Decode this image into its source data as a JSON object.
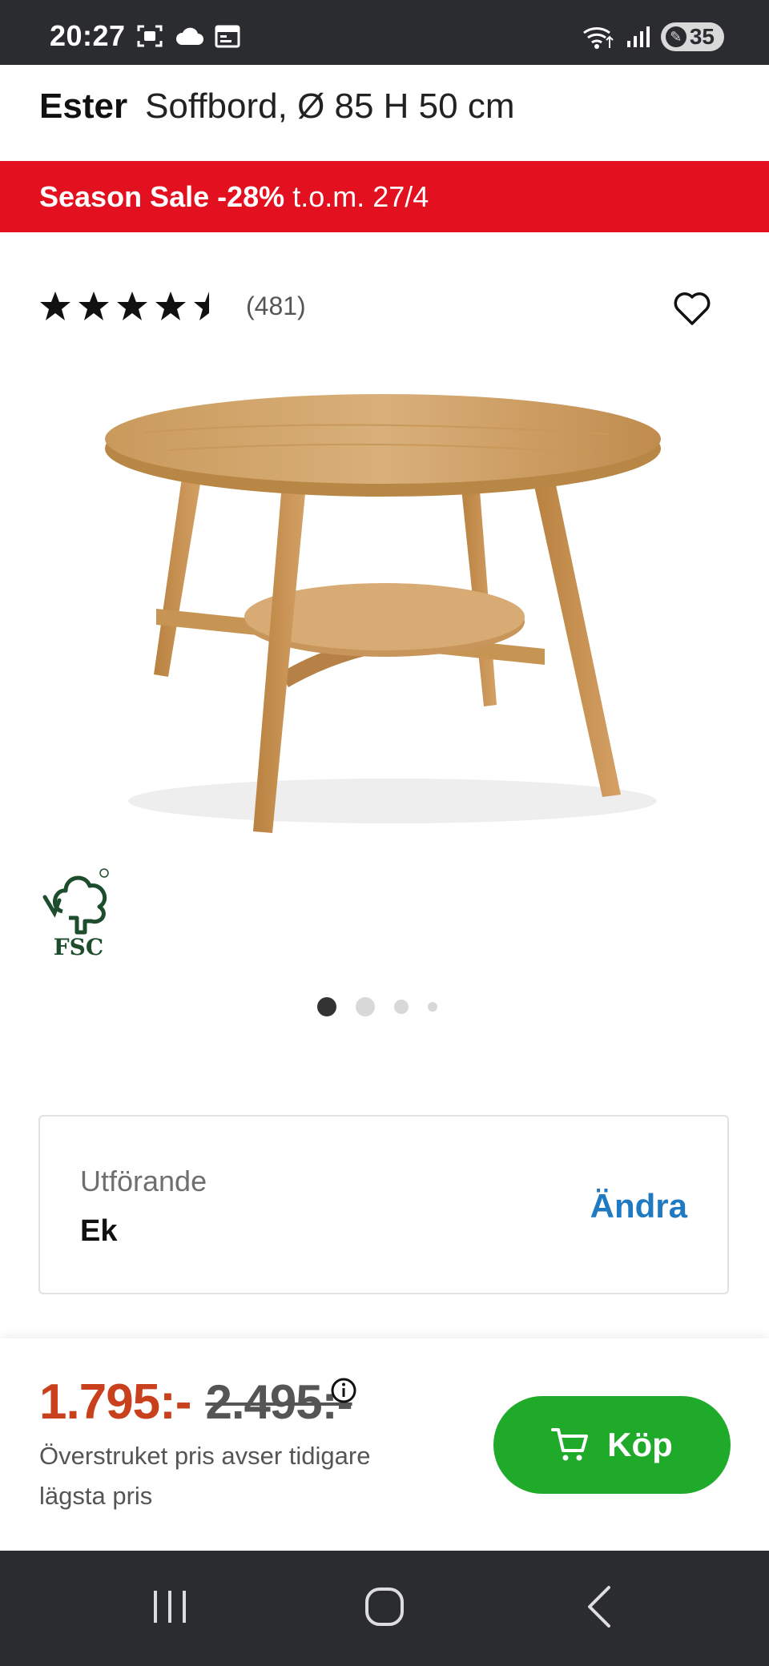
{
  "status_bar": {
    "time": "20:27",
    "battery": "35",
    "icons_left": [
      "screenshot-icon",
      "cloud-icon",
      "calendar-icon"
    ],
    "icons_right": [
      "wifi-icon",
      "signal-icon",
      "battery-icon"
    ]
  },
  "product": {
    "brand": "Ester",
    "name": "Soffbord, Ø 85 H 50 cm",
    "review_count": "(481)",
    "rating": 4.5,
    "max_rating": 5
  },
  "sale_banner": {
    "label": "Season Sale",
    "discount": "-28%",
    "until": "t.o.m. 27/4"
  },
  "certification": {
    "label": "FSC"
  },
  "carousel": {
    "active_index": 0,
    "count": 4
  },
  "option": {
    "label": "Utförande",
    "value": "Ek",
    "change_label": "Ändra"
  },
  "pricing": {
    "current": "1.795:-",
    "original": "2.495:-",
    "note": "Överstruket pris avser tidigare lägsta pris",
    "buy_label": "Köp"
  },
  "colors": {
    "sale_red": "#e3101f",
    "price_orange": "#c9411c",
    "buy_green": "#1faa2a",
    "link_blue": "#1f7ac2",
    "system_bar": "#2b2c30"
  }
}
